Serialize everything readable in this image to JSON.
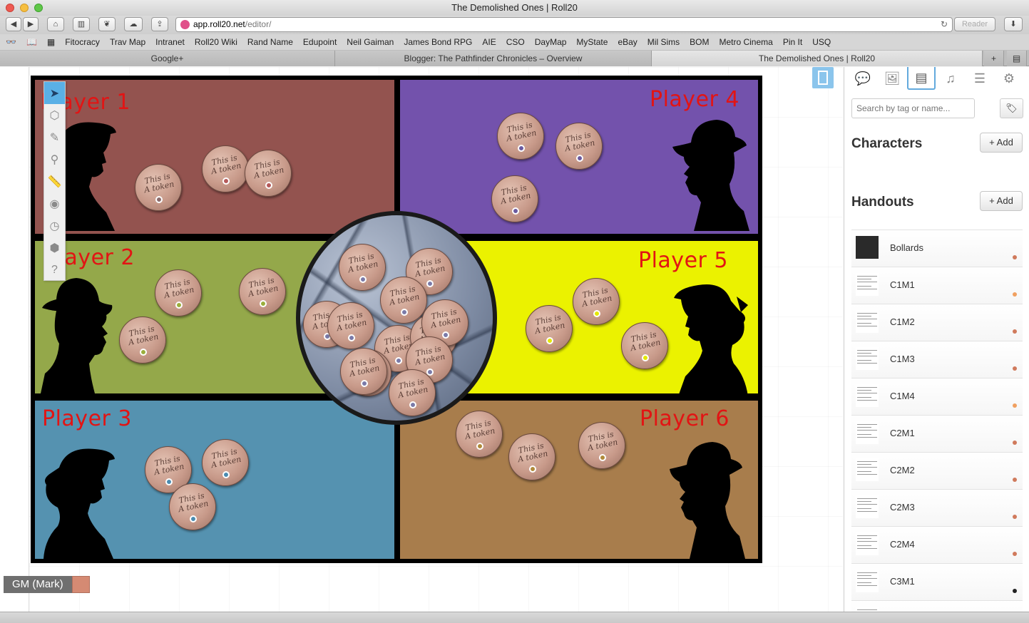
{
  "window": {
    "title": "The Demolished Ones | Roll20"
  },
  "toolbar": {
    "url_host": "app.roll20.net",
    "url_path": "/editor/",
    "reader_label": "Reader"
  },
  "bookmarks": [
    "Fitocracy",
    "Trav Map",
    "Intranet",
    "Roll20 Wiki",
    "Rand Name",
    "Edupoint",
    "Neil Gaiman",
    "James Bond RPG",
    "AIE",
    "CSO",
    "DayMap",
    "MyState",
    "eBay",
    "Mil Sims",
    "BOM",
    "Metro Cinema",
    "Pin It",
    "USQ"
  ],
  "tabs": [
    {
      "label": "Google+"
    },
    {
      "label": "Blogger: The Pathfinder Chronicles – Overview"
    },
    {
      "label": "The Demolished Ones | Roll20"
    }
  ],
  "board": {
    "zones": [
      {
        "label": "Player 1",
        "color": "#93534f"
      },
      {
        "label": "Player 4",
        "color": "#7352ac"
      },
      {
        "label": "Player 2",
        "color": "#94a84a"
      },
      {
        "label": "Player 5",
        "color": "#ebf200"
      },
      {
        "label": "Player 3",
        "color": "#5592b0"
      },
      {
        "label": "Player 6",
        "color": "#a87d4c"
      }
    ],
    "coin_text": "This is\nA token"
  },
  "player": {
    "name": "GM (Mark)",
    "color": "#d58a73"
  },
  "sidebar": {
    "search_placeholder": "Search by tag or name...",
    "characters_title": "Characters",
    "handouts_title": "Handouts",
    "add_label": "Add",
    "handouts": [
      {
        "name": "Bollards",
        "dot": "#d07a5c",
        "thumb": "dark"
      },
      {
        "name": "C1M1",
        "dot": "#f0a060",
        "thumb": "doc"
      },
      {
        "name": "C1M2",
        "dot": "#d07a5c",
        "thumb": "doc"
      },
      {
        "name": "C1M3",
        "dot": "#d07a5c",
        "thumb": "doc"
      },
      {
        "name": "C1M4",
        "dot": "#f0a060",
        "thumb": "doc"
      },
      {
        "name": "C2M1",
        "dot": "#d07a5c",
        "thumb": "doc"
      },
      {
        "name": "C2M2",
        "dot": "#d07a5c",
        "thumb": "doc"
      },
      {
        "name": "C2M3",
        "dot": "#d07a5c",
        "thumb": "doc"
      },
      {
        "name": "C2M4",
        "dot": "#d07a5c",
        "thumb": "doc"
      },
      {
        "name": "C3M1",
        "dot": "#222222",
        "thumb": "doc"
      },
      {
        "name": "",
        "dot": "",
        "thumb": "doc"
      }
    ]
  }
}
